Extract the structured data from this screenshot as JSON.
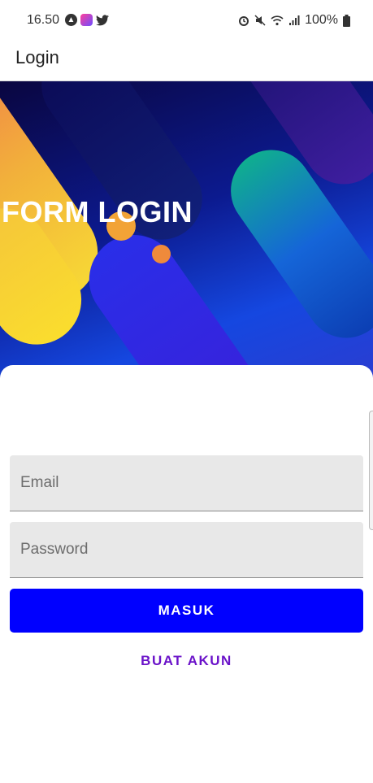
{
  "status_bar": {
    "time": "16.50",
    "battery": "100%",
    "icons_left": [
      "android-auto-icon",
      "app-notification-icon",
      "twitter-icon"
    ],
    "icons_right": [
      "alarm-icon",
      "mute-icon",
      "wifi-icon",
      "signal-icon",
      "battery-icon"
    ]
  },
  "app_bar": {
    "title": "Login"
  },
  "banner": {
    "title": "FORM LOGIN"
  },
  "form": {
    "email_placeholder": "Email",
    "email_value": "",
    "password_placeholder": "Password",
    "password_value": "",
    "login_button": "MASUK",
    "register_button": "BUAT AKUN"
  },
  "colors": {
    "primary_button": "#0000ff",
    "text_button": "#6a12c9",
    "field_background": "#e8e8e8"
  }
}
